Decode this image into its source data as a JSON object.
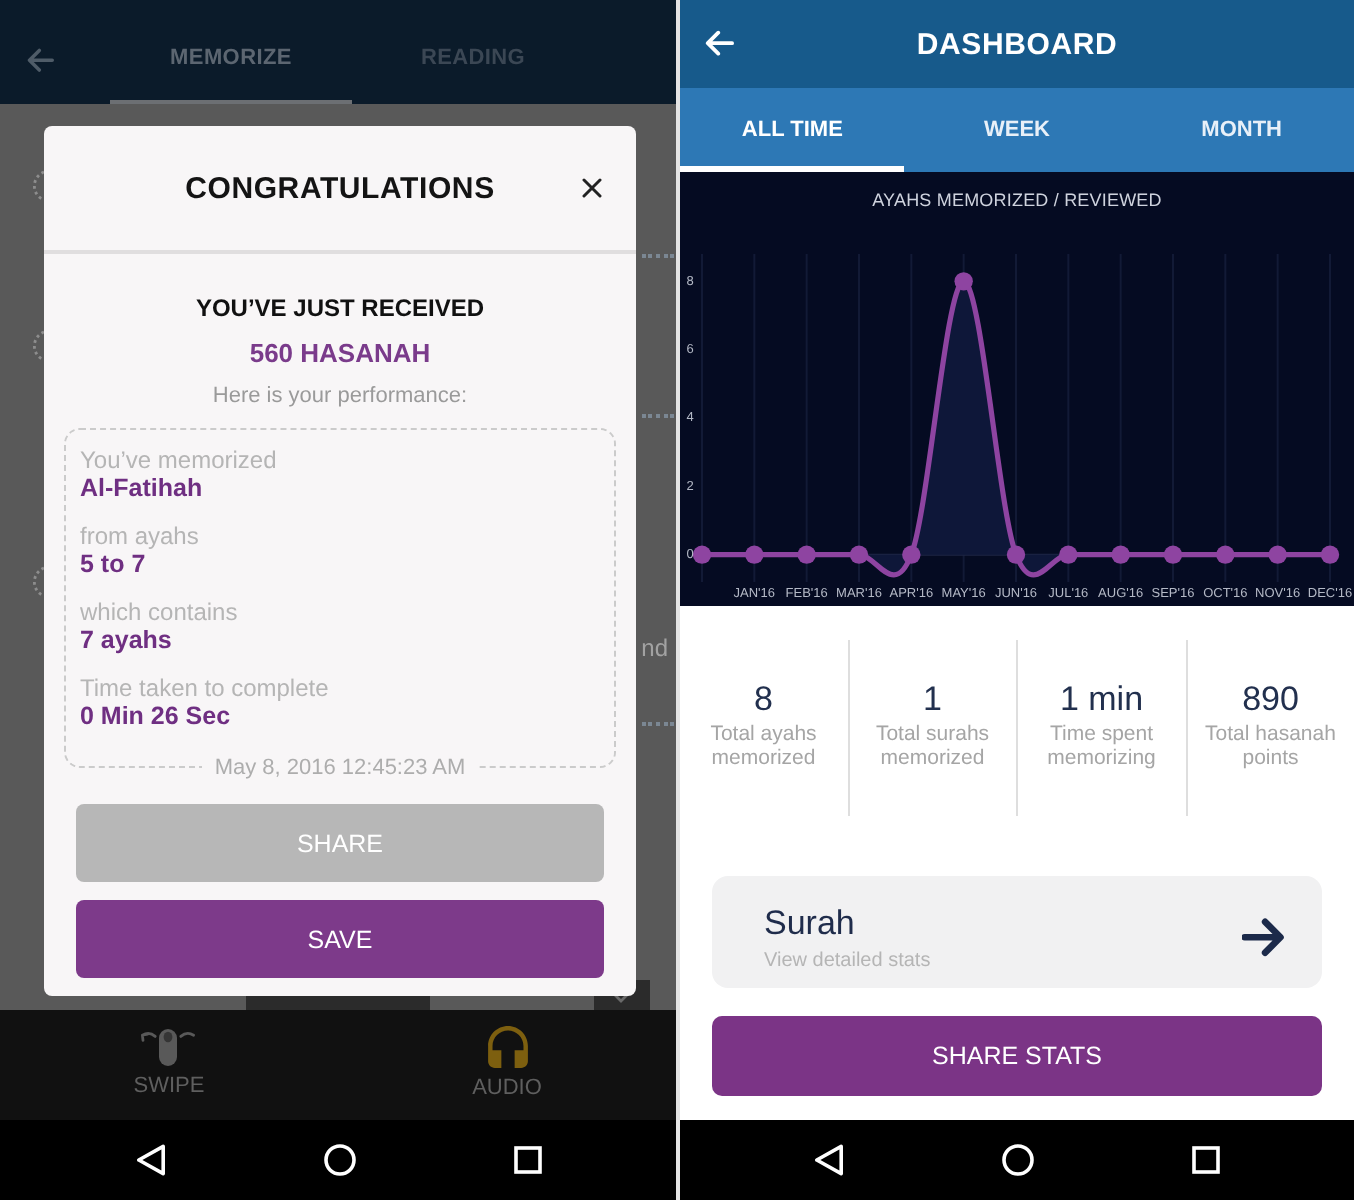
{
  "memorize_screen": {
    "tabs": [
      {
        "label": "MEMORIZE",
        "selected": true
      },
      {
        "label": "READING",
        "selected": false
      }
    ],
    "background_fragment": "nd",
    "dialog": {
      "title": "CONGRATULATIONS",
      "heading": "YOU’VE JUST RECEIVED",
      "reward": "560 HASANAH",
      "intro": "Here is your performance:",
      "details": [
        {
          "label": "You’ve memorized",
          "value": "Al-Fatihah"
        },
        {
          "label": "from ayahs",
          "value": "5 to 7"
        },
        {
          "label": "which contains",
          "value": "7 ayahs"
        },
        {
          "label": "Time taken to complete",
          "value": "0 Min 26 Sec"
        }
      ],
      "timestamp": "May 8, 2016 12:45:23 AM",
      "buttons": [
        {
          "label": "SHARE",
          "disabled": true
        },
        {
          "label": "SAVE",
          "disabled": false
        }
      ]
    },
    "bottom_nav": [
      {
        "kind": "swipe",
        "label": "SWIPE",
        "selected": false
      },
      {
        "kind": "audio",
        "label": "AUDIO",
        "selected": true
      }
    ]
  },
  "dashboard_screen": {
    "title": "DASHBOARD",
    "tabs": [
      {
        "label": "ALL TIME",
        "selected": true
      },
      {
        "label": "WEEK",
        "selected": false
      },
      {
        "label": "MONTH",
        "selected": false
      }
    ],
    "chart_data": {
      "type": "area",
      "title": "AYAHS MEMORIZED / REVIEWED",
      "categories": [
        null,
        "JAN'16",
        "FEB'16",
        "MAR'16",
        "APR'16",
        "MAY'16",
        "JUN'16",
        "JUL'16",
        "AUG'16",
        "SEP'16",
        "OCT'16",
        "NOV'16",
        "DEC'16"
      ],
      "values": [
        0,
        0,
        0,
        0,
        0,
        8,
        0,
        0,
        0,
        0,
        0,
        0,
        0
      ],
      "ylim": [
        -0.8,
        8.8
      ],
      "yticks": [
        0,
        2,
        4,
        6,
        8
      ],
      "grid": true
    },
    "stats": [
      {
        "value": "8",
        "label": "Total ayahs memorized"
      },
      {
        "value": "1",
        "label": "Total surahs memorized"
      },
      {
        "value": "1 min",
        "label": "Time spent memorizing"
      },
      {
        "value": "890",
        "label": "Total hasanah points"
      }
    ],
    "detail_card": {
      "title": "Surah",
      "subtitle": "View detailed stats"
    },
    "share_button": "SHARE STATS"
  }
}
